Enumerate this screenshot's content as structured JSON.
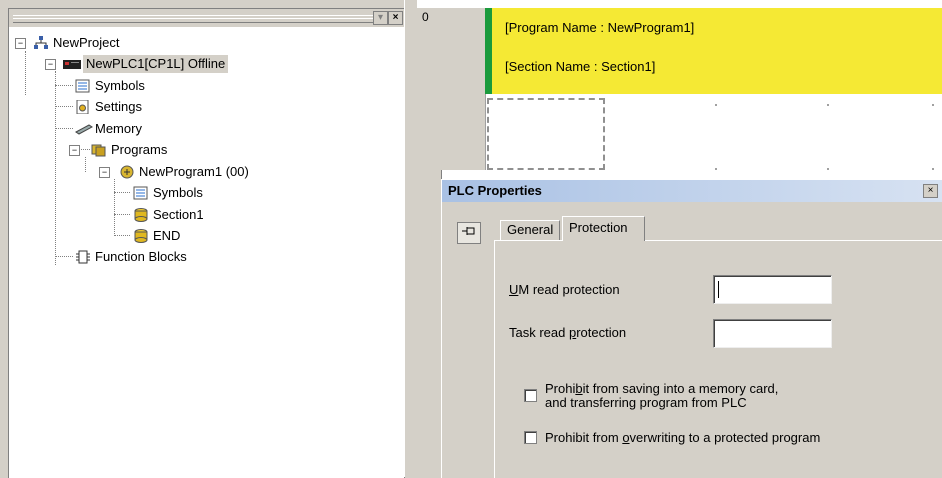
{
  "tree": {
    "nodes": {
      "project": "NewProject",
      "plc": "NewPLC1[CP1L] Offline",
      "symbols": "Symbols",
      "settings": "Settings",
      "memory": "Memory",
      "programs": "Programs",
      "program1": "NewProgram1 (00)",
      "program_symbols": "Symbols",
      "section1": "Section1",
      "end": "END",
      "function_blocks": "Function Blocks"
    },
    "expander_symbol": "−"
  },
  "ladder": {
    "rung_number": "0",
    "program_name": "[Program Name : NewProgram1]",
    "section_name": "[Section Name : Section1]",
    "comment_color": "#f5e934",
    "rail_color": "#1a9a3c"
  },
  "dialog": {
    "title": "PLC Properties",
    "close": "×",
    "tabs": {
      "general": "General",
      "protection": "Protection"
    },
    "fields": {
      "um_read_prefix": "U",
      "um_read_rest": "M read protection",
      "um_read_value": "",
      "task_read_prefix": "Task read ",
      "task_read_p": "p",
      "task_read_rest": "rotection",
      "task_read_value": ""
    },
    "checkboxes": {
      "memory_card_line1_a": "Prohi",
      "memory_card_line1_b": "b",
      "memory_card_line1_c": "it from saving into a memory card,",
      "memory_card_line2": "and transferring program from PLC",
      "memory_card_checked": false,
      "overwrite_a": "Prohibit from ",
      "overwrite_b": "o",
      "overwrite_c": "verwriting to a protected program",
      "overwrite_checked": false
    }
  }
}
